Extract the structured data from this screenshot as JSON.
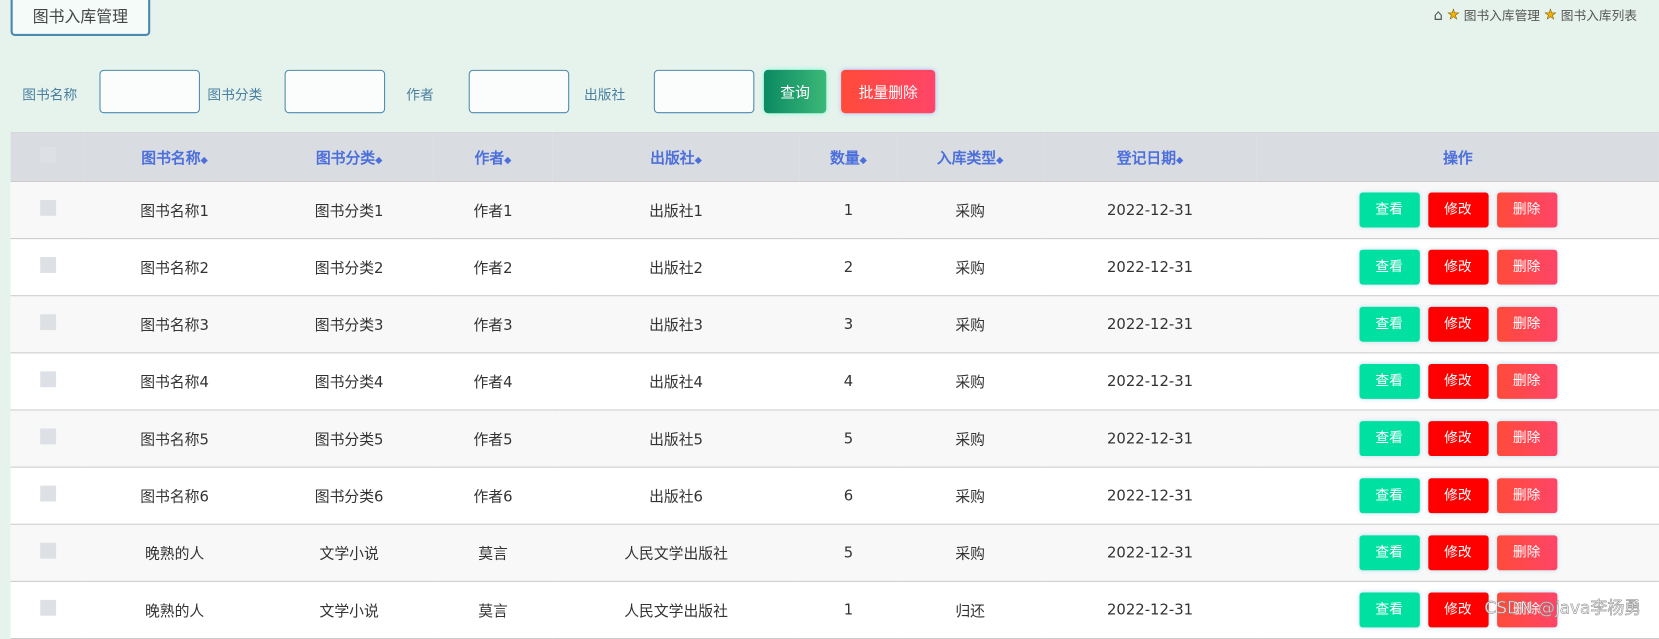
{
  "page_title": "图书入库管理",
  "breadcrumb": {
    "items": [
      "图书入库管理",
      "图书入库列表"
    ]
  },
  "search": {
    "fields": [
      {
        "label": "图书名称",
        "value": ""
      },
      {
        "label": "图书分类",
        "value": ""
      },
      {
        "label": "作者",
        "value": ""
      },
      {
        "label": "出版社",
        "value": ""
      }
    ],
    "query_label": "查询",
    "batch_delete_label": "批量删除"
  },
  "table": {
    "headers": [
      "图书名称",
      "图书分类",
      "作者",
      "出版社",
      "数量",
      "入库类型",
      "登记日期",
      "操作"
    ],
    "actions": {
      "view": "查看",
      "edit": "修改",
      "delete": "删除"
    },
    "rows": [
      [
        "图书名称1",
        "图书分类1",
        "作者1",
        "出版社1",
        "1",
        "采购",
        "2022-12-31"
      ],
      [
        "图书名称2",
        "图书分类2",
        "作者2",
        "出版社2",
        "2",
        "采购",
        "2022-12-31"
      ],
      [
        "图书名称3",
        "图书分类3",
        "作者3",
        "出版社3",
        "3",
        "采购",
        "2022-12-31"
      ],
      [
        "图书名称4",
        "图书分类4",
        "作者4",
        "出版社4",
        "4",
        "采购",
        "2022-12-31"
      ],
      [
        "图书名称5",
        "图书分类5",
        "作者5",
        "出版社5",
        "5",
        "采购",
        "2022-12-31"
      ],
      [
        "图书名称6",
        "图书分类6",
        "作者6",
        "出版社6",
        "6",
        "采购",
        "2022-12-31"
      ],
      [
        "晚熟的人",
        "文学小说",
        "莫言",
        "人民文学出版社",
        "5",
        "采购",
        "2022-12-31"
      ],
      [
        "晚熟的人",
        "文学小说",
        "莫言",
        "人民文学出版社",
        "1",
        "归还",
        "2022-12-31"
      ]
    ]
  },
  "watermark": "CSDN @java李杨勇"
}
